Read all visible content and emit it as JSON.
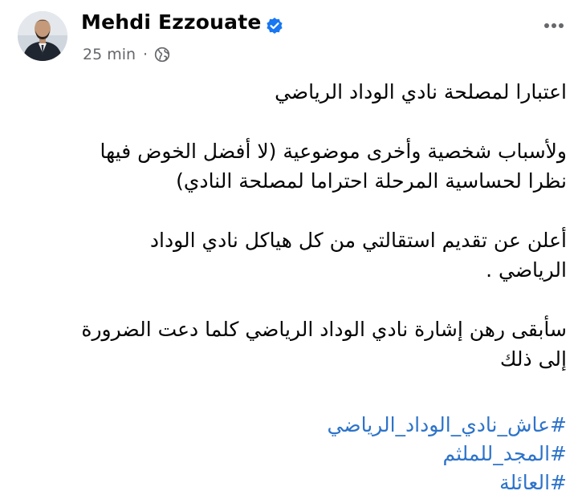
{
  "post": {
    "author": "Mehdi Ezzouate",
    "time": "25 min",
    "separator": "·",
    "paragraphs": [
      "اعتبارا لمصلحة نادي الوداد الرياضي",
      "ولأسباب شخصية وأخرى موضوعية (لا أفضل الخوض فيها\nنظرا لحساسية المرحلة احتراما لمصلحة النادي)",
      "أعلن عن تقديم استقالتي من كل هياكل نادي الوداد\nالرياضي .",
      "سأبقى رهن إشارة نادي الوداد الرياضي كلما دعت الضرورة\nإلى ذلك"
    ],
    "hashtags": [
      "#عاش_نادي_الوداد_الرياضي",
      "#المجد_للملثم",
      "#العائلة"
    ]
  },
  "colors": {
    "verified": "#1877f2",
    "hashtag": "#2d73c9",
    "meta": "#65676b"
  },
  "icons": {
    "verified": "verified-badge-icon",
    "audience": "globe-icon",
    "more": "more-dots-icon"
  }
}
